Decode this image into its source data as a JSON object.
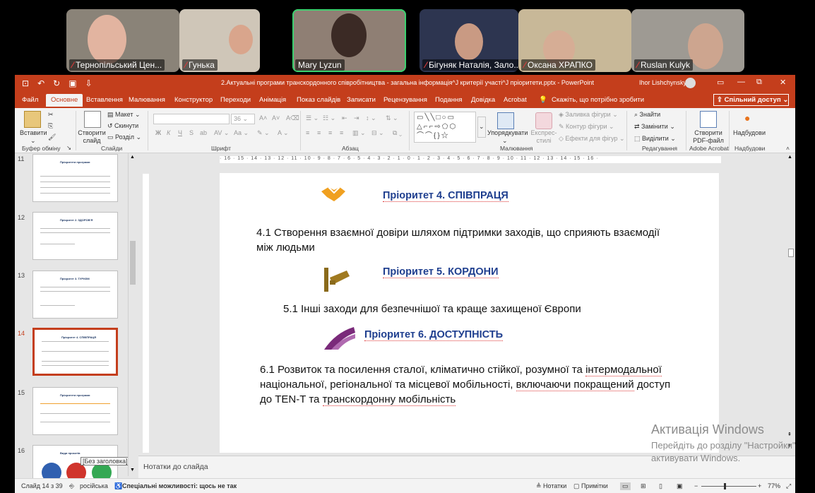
{
  "participants": [
    {
      "name": "Тернопільський Цен...",
      "muted": true
    },
    {
      "name": "Гунька",
      "muted": true
    },
    {
      "name": "Mary Lyzun",
      "muted": false,
      "active": true
    },
    {
      "name": "Бігуняк Наталія, Зало...",
      "muted": true
    },
    {
      "name": "Оксана ХРАПКО",
      "muted": true
    },
    {
      "name": "Ruslan Kulyk",
      "muted": true
    }
  ],
  "window": {
    "document_title": "2.Актуальні програми транскордонного співробітництва - загальна інформація^J критерії участі^J пріоритети.pptx  -  PowerPoint",
    "user": "Ihor Lishchynskyy"
  },
  "tabs": [
    "Файл",
    "Основне",
    "Вставлення",
    "Малювання",
    "Конструктор",
    "Переходи",
    "Анімація",
    "Показ слайдів",
    "Записати",
    "Рецензування",
    "Подання",
    "Довідка",
    "Acrobat"
  ],
  "tell_me": "Скажіть, що потрібно зробити",
  "share_label": "Спільний доступ",
  "ribbon": {
    "paste": "Вставити",
    "new_slide": "Створити слайд",
    "layout": "Макет",
    "reset": "Скинути",
    "section": "Розділ",
    "font_size": "36",
    "arrange": "Упорядкувати",
    "quick_styles": "Експрес-стилі",
    "shape_fill": "Заливка фігури",
    "shape_outline": "Контур фігури",
    "shape_effects": "Ефекти для фігур",
    "find": "Знайти",
    "replace": "Замінити",
    "select": "Виділити",
    "create_pdf": "Створити PDF-файл",
    "addins": "Надбудови",
    "groups": [
      "Буфер обміну",
      "Слайди",
      "Шрифт",
      "Абзац",
      "Малювання",
      "Редагування",
      "Adobe Acrobat",
      "Надбудови"
    ]
  },
  "thumbnails": [
    {
      "num": "11",
      "title": "Пріоритети програми"
    },
    {
      "num": "12",
      "title": "Пріоритет 2. ЗДОРОВ'Я"
    },
    {
      "num": "13",
      "title": "Пріоритет 3. ТУРИЗМ"
    },
    {
      "num": "14",
      "title": "Пріоритет 4. СПІВПРАЦЯ",
      "selected": true
    },
    {
      "num": "15",
      "title": "Пріоритети програми"
    },
    {
      "num": "16",
      "title": "Види проєктів"
    }
  ],
  "tooltip": "[Без заголовка]",
  "ruler_text": "· 16 · 15 · 14 · 13 · 12 · 11 · 10 · 9 · 8 · 7 · 6 · 5 · 4 · 3 · 2 · 1 · 0 · 1 · 2 · 3 · 4 · 5 · 6 · 7 · 8 · 9 · 10 · 11 · 12 · 13 · 14 · 15 · 16 ·",
  "slide": {
    "p4_title": "Пріоритет 4. СПІВПРАЦЯ",
    "p4_text": "4.1 Створення взаємної довіри шляхом підтримки заходів, що сприяють взаємодії між людьми",
    "p5_title": "Пріоритет 5. КОРДОНИ",
    "p5_text": "5.1 Інші заходи для безпечнішої та краще захищеної Європи",
    "p6_title": "Пріоритет 6. ДОСТУПНІСТЬ",
    "p6_text_a": "6.1 Розвиток та посилення сталої, кліматично стійкої, розумної та ",
    "p6_text_b": "інтермодальної",
    "p6_text_c": " національної, регіональної та місцевої мобільності, ",
    "p6_text_d": "включаючи покращений",
    "p6_text_e": " доступ до TEN-T та ",
    "p6_text_f": "транскордонну мобільність"
  },
  "notes_placeholder": "Нотатки до слайда",
  "status": {
    "slide": "Слайд 14 з 39",
    "lang": "російська",
    "accessibility": "Спеціальні можливості: щось не так",
    "notes": "Нотатки",
    "comments": "Примітки",
    "zoom": "77%"
  },
  "watermark": {
    "line1": "Активація Windows",
    "line2": "Перейдіть до розділу \"Настройки\"",
    "line3": "активувати Windows."
  }
}
